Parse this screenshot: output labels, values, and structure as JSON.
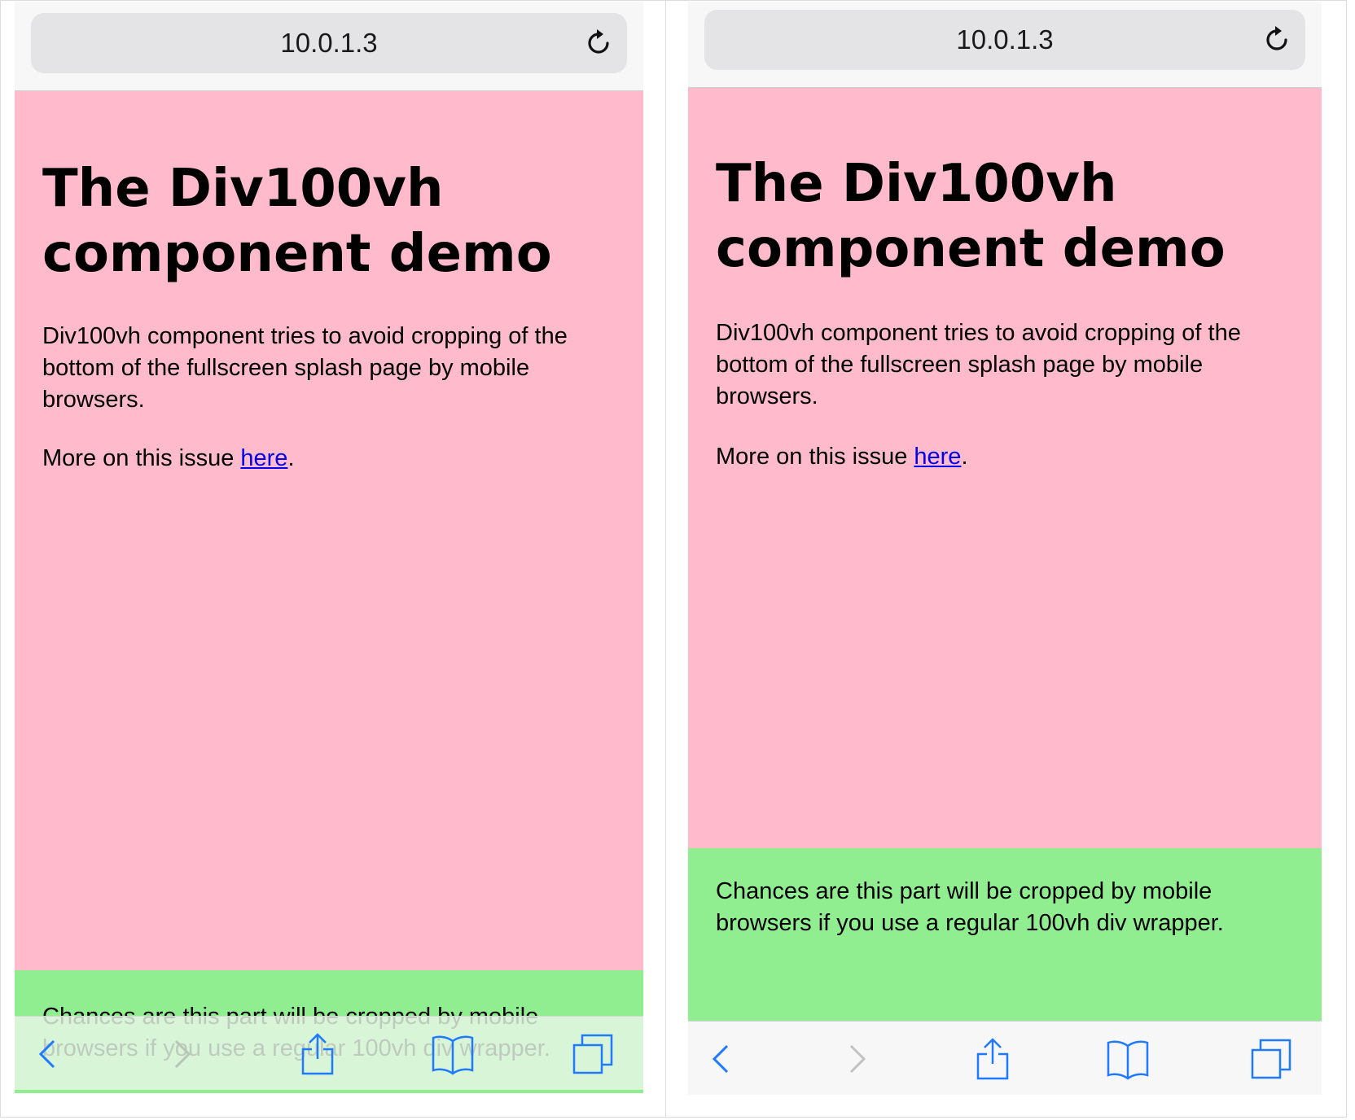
{
  "colors": {
    "accent": "#1f7aff",
    "disabled": "#b8c4b8",
    "pink": "#ffbacb",
    "green": "#90ee90",
    "link": "#0000ee"
  },
  "screens": [
    {
      "url": "10.0.1.3",
      "heading_line1": "The Div100vh",
      "heading_line2": "component demo",
      "intro": "Div100vh component tries to avoid cropping of the bottom of the fullscreen splash page by mobile browsers.",
      "more_prefix": "More on this issue ",
      "more_link": "here",
      "more_suffix": ".",
      "bottom_text": "Chances are this part will be cropped by mobile browsers if you use a regular 100vh div wrapper.",
      "toolbar_icons": [
        "back-icon",
        "forward-icon",
        "share-icon",
        "bookmarks-icon",
        "tabs-icon"
      ]
    },
    {
      "url": "10.0.1.3",
      "heading_line1": "The Div100vh",
      "heading_line2": "component demo",
      "intro": "Div100vh component tries to avoid cropping of the bottom of the fullscreen splash page by mobile browsers.",
      "more_prefix": "More on this issue ",
      "more_link": "here",
      "more_suffix": ".",
      "bottom_text": "Chances are this part will be cropped by mobile browsers if you use a regular 100vh div wrapper.",
      "toolbar_icons": [
        "back-icon",
        "forward-icon",
        "share-icon",
        "bookmarks-icon",
        "tabs-icon"
      ]
    }
  ]
}
